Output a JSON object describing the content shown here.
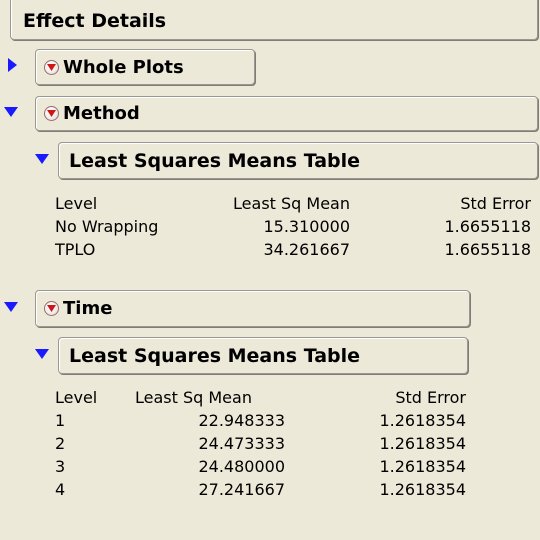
{
  "effect_details": {
    "title": "Effect Details"
  },
  "whole_plots": {
    "title": "Whole Plots"
  },
  "method": {
    "title": "Method",
    "lsm_table": {
      "title": "Least Squares Means Table",
      "headers": [
        "Level",
        "Least Sq Mean",
        "Std Error"
      ],
      "rows": [
        [
          "No Wrapping",
          "15.310000",
          "1.6655118"
        ],
        [
          "TPLO",
          "34.261667",
          "1.6655118"
        ]
      ]
    }
  },
  "time": {
    "title": "Time",
    "lsm_table": {
      "title": "Least Squares Means Table",
      "headers": [
        "Level",
        "Least Sq Mean",
        "Std Error"
      ],
      "rows": [
        [
          "1",
          "22.948333",
          "1.2618354"
        ],
        [
          "2",
          "24.473333",
          "1.2618354"
        ],
        [
          "3",
          "24.480000",
          "1.2618354"
        ],
        [
          "4",
          "27.241667",
          "1.2618354"
        ]
      ]
    }
  },
  "colors": {
    "background": "#ece9d8",
    "disclosure_triangle": "#1a1aff",
    "menu_triangle": "#d01515"
  },
  "icons": {
    "disclosure_open": "triangle-down-icon",
    "disclosure_closed": "triangle-right-icon",
    "menu": "red-triangle-menu-icon"
  }
}
